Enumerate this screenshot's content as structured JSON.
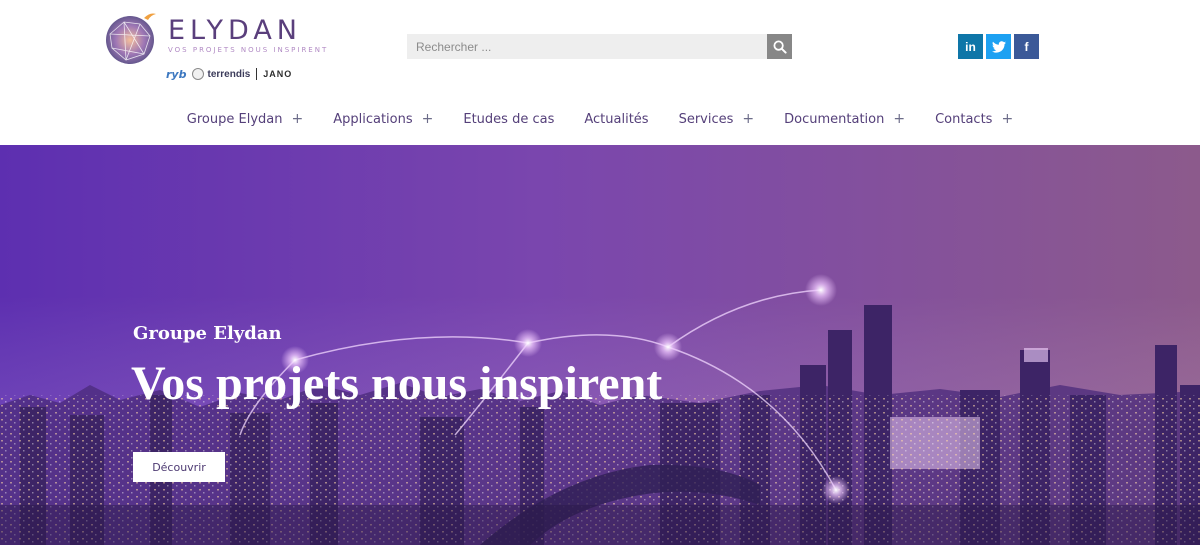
{
  "brand": {
    "name": "ELYDAN",
    "tagline": "VOS PROJETS NOUS INSPIRENT",
    "partners": [
      "ryb",
      "terrendis",
      "JANO"
    ]
  },
  "search": {
    "placeholder": "Rechercher ..."
  },
  "social": {
    "linkedin_label": "in",
    "twitter_icon": "twitter-icon",
    "facebook_label": "f"
  },
  "nav": {
    "items": [
      {
        "label": "Groupe Elydan",
        "plus": "+"
      },
      {
        "label": "Applications",
        "plus": "+"
      },
      {
        "label": "Etudes de cas",
        "plus": ""
      },
      {
        "label": "Actualités",
        "plus": ""
      },
      {
        "label": "Services",
        "plus": "+"
      },
      {
        "label": "Documentation",
        "plus": "+"
      },
      {
        "label": "Contacts",
        "plus": "+"
      }
    ]
  },
  "hero": {
    "subtitle": "Groupe Elydan",
    "title": "Vos projets nous inspirent",
    "button_label": "Découvrir"
  },
  "colors": {
    "brand_purple": "#5a3f7c",
    "nav_text": "#55407a",
    "search_button": "#878787",
    "linkedin": "#0e76a8",
    "twitter": "#1da1f2",
    "facebook": "#3b5998"
  }
}
